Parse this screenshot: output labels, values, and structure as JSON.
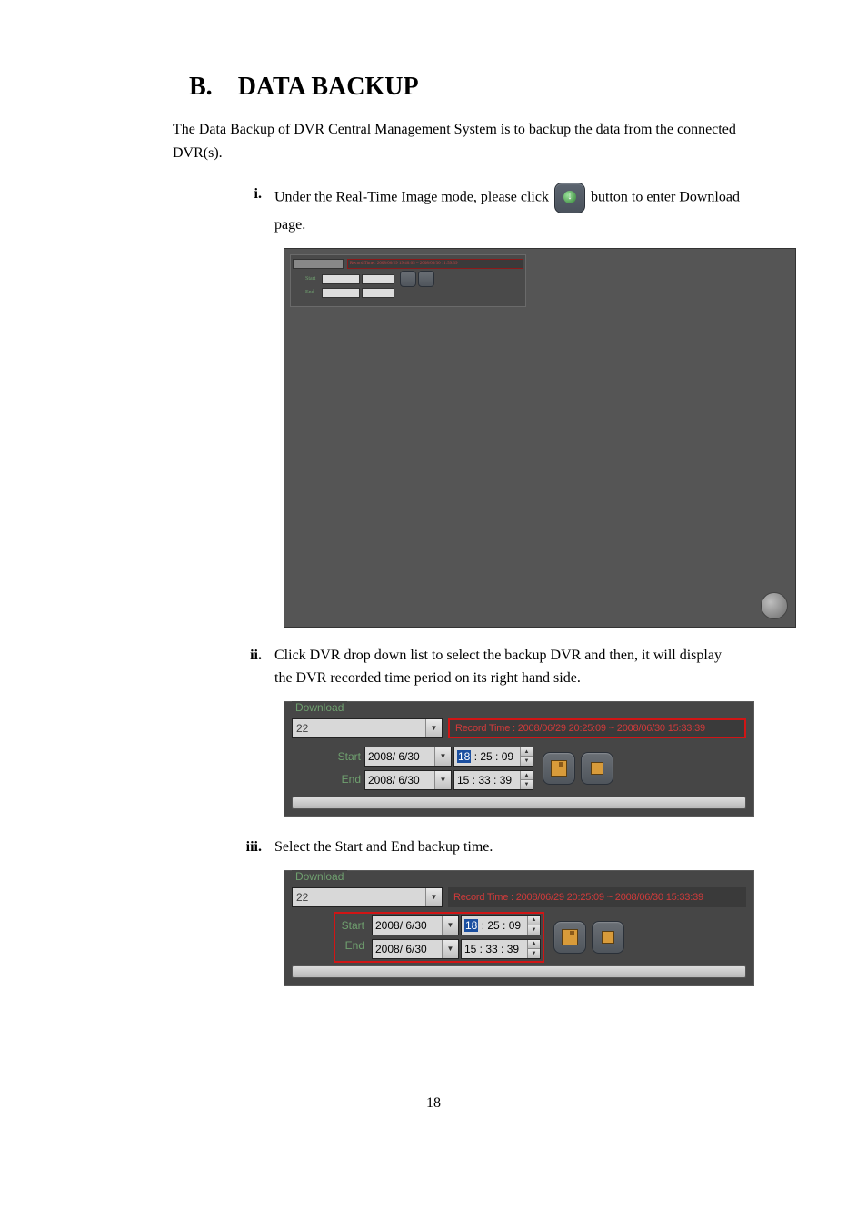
{
  "heading": {
    "letter": "B.",
    "title": "DATA BACKUP"
  },
  "intro": "The Data Backup of DVR Central Management System is to backup the data from the connected DVR(s).",
  "items": {
    "i": {
      "marker": "i.",
      "text_before": "Under the Real-Time Image mode, please click ",
      "text_after": " button to enter Download page."
    },
    "ii": {
      "marker": "ii.",
      "text": "Click DVR drop down list to select the backup DVR and then, it will display the DVR recorded time period on its right hand side."
    },
    "iii": {
      "marker": "iii.",
      "text": "Select the Start and End backup time."
    }
  },
  "panel": {
    "legend": "Download",
    "dvr_value": "22",
    "record_time": "Record Time : 2008/06/29 20:25:09 ~ 2008/06/30 15:33:39",
    "start_label": "Start",
    "end_label": "End",
    "start_date": "2008/ 6/30",
    "start_time_hh": "18",
    "start_time_rest": " : 25 : 09",
    "end_date": "2008/ 6/30",
    "end_time": "15 : 33 : 39"
  },
  "tiny": {
    "record_time": "Record Time : 2008/06/29 19:40:05 ~ 2008/06/30 11:59:39"
  },
  "page_number": "18"
}
